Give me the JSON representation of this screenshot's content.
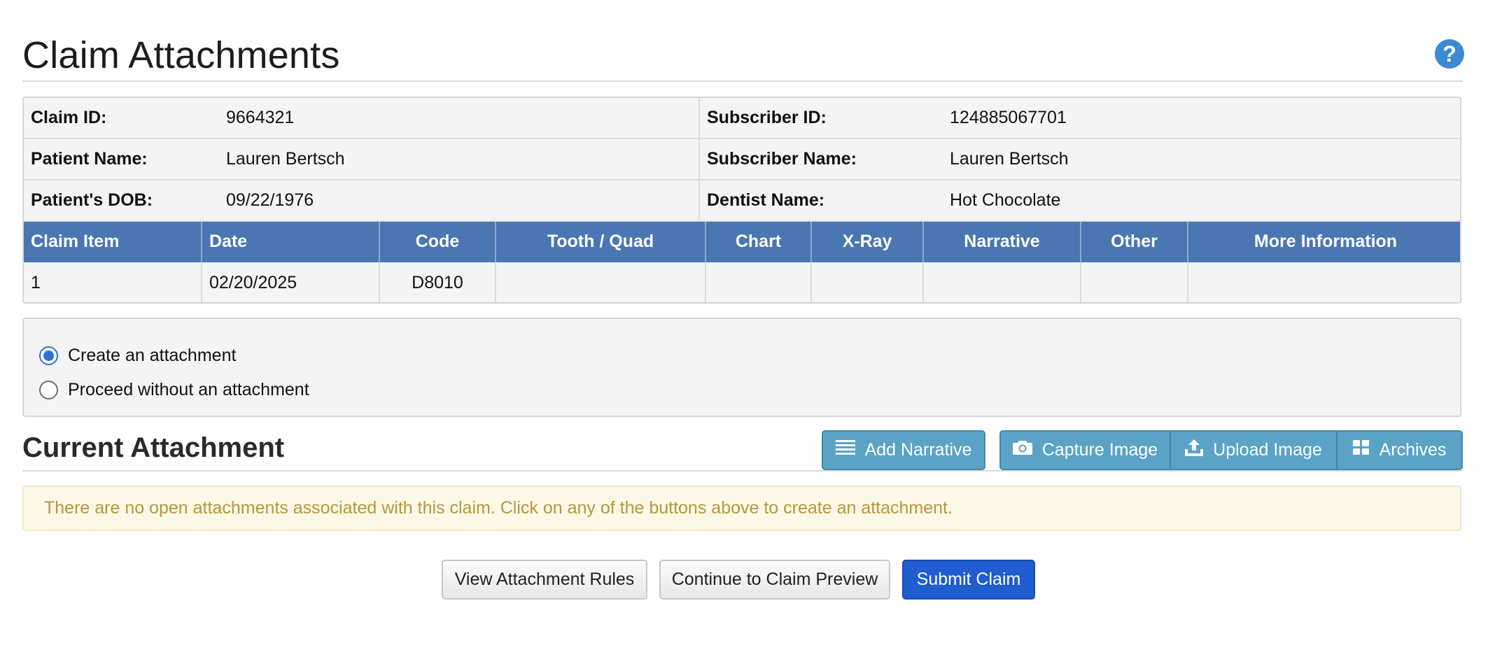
{
  "page": {
    "title": "Claim Attachments",
    "help_icon": "question-circle-icon"
  },
  "claim_info": {
    "claim_id_label": "Claim ID:",
    "claim_id": "9664321",
    "subscriber_id_label": "Subscriber ID:",
    "subscriber_id": "124885067701",
    "patient_name_label": "Patient Name:",
    "patient_name": "Lauren Bertsch",
    "subscriber_name_label": "Subscriber Name:",
    "subscriber_name": "Lauren Bertsch",
    "patient_dob_label": "Patient's DOB:",
    "patient_dob": "09/22/1976",
    "dentist_name_label": "Dentist Name:",
    "dentist_name": "Hot Chocolate"
  },
  "items_table": {
    "columns": [
      "Claim Item",
      "Date",
      "Code",
      "Tooth / Quad",
      "Chart",
      "X-Ray",
      "Narrative",
      "Other",
      "More Information"
    ],
    "rows": [
      {
        "claim_item": "1",
        "date": "02/20/2025",
        "code": "D8010",
        "tooth_quad": "",
        "chart": "",
        "xray": "",
        "narrative": "",
        "other": "",
        "more_information": ""
      }
    ]
  },
  "attachment_options": {
    "selected": "create",
    "create_label": "Create an attachment",
    "proceed_label": "Proceed without an attachment"
  },
  "current_attachment": {
    "title": "Current Attachment",
    "buttons": {
      "add_narrative": "Add Narrative",
      "capture_image": "Capture Image",
      "upload_image": "Upload Image",
      "archives": "Archives"
    },
    "notice": "There are no open attachments associated with this claim. Click on any of the buttons above to create an attachment."
  },
  "actions": {
    "view_rules": "View Attachment Rules",
    "continue_preview": "Continue to Claim Preview",
    "submit": "Submit Claim"
  },
  "colors": {
    "table_header": "#4a76b2",
    "toolbar_button": "#5aa3c6",
    "submit_button": "#1f5dd0",
    "notice_text": "#b8963e",
    "notice_bg": "#fcf8e6",
    "help_icon": "#3b8ad2"
  }
}
